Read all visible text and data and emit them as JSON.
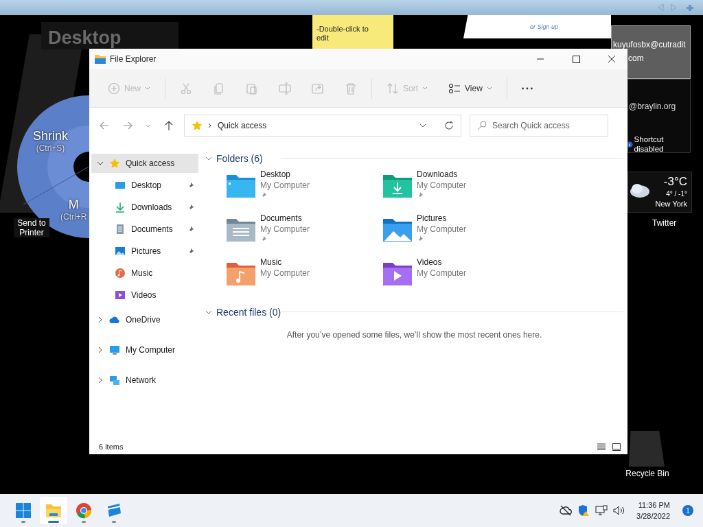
{
  "desktop": {
    "title": "Desktop",
    "disc_labels": [
      {
        "label": "Shrink",
        "shortcut": "(Ctrl+S)"
      },
      {
        "label": "M",
        "shortcut": "(Ctrl+R"
      }
    ],
    "sticky_note": "-Double-click to edit",
    "login_link": "or Sign up",
    "email": {
      "address_lines": [
        "kuyufosbx@cutradit",
        "com"
      ],
      "second_address": "@braylin.org",
      "notice": "Shortcut disabled"
    },
    "weather": {
      "temperature": "-3°C",
      "range": "4° / -1°",
      "city": "New York"
    },
    "icons": [
      {
        "label": "Send to Printer"
      },
      {
        "label": "Twitter"
      },
      {
        "label": "Recycle Bin"
      }
    ]
  },
  "window": {
    "title": "File Explorer",
    "toolbar": [
      {
        "kind": "new",
        "label": "New",
        "disabled": true,
        "dropdown": true
      },
      {
        "kind": "cut",
        "disabled": true
      },
      {
        "kind": "copy",
        "disabled": true
      },
      {
        "kind": "paste",
        "disabled": true
      },
      {
        "kind": "rename",
        "disabled": true
      },
      {
        "kind": "share",
        "disabled": true
      },
      {
        "kind": "delete",
        "disabled": true
      },
      {
        "kind": "sort",
        "label": "Sort",
        "disabled": true,
        "dropdown": true
      },
      {
        "kind": "view",
        "label": "View",
        "disabled": false,
        "dropdown": true
      },
      {
        "kind": "more",
        "disabled": false
      }
    ],
    "address": {
      "path": "Quick access"
    },
    "search": {
      "placeholder": "Search Quick access"
    },
    "sidebar": [
      {
        "label": "Quick access",
        "kind": "star",
        "expanded": true,
        "selected": true,
        "children": [
          {
            "label": "Desktop",
            "kind": "desktop",
            "pinned": true,
            "selected": false
          },
          {
            "label": "Downloads",
            "kind": "downloads",
            "pinned": true,
            "selected": false
          },
          {
            "label": "Documents",
            "kind": "documents",
            "pinned": true,
            "selected": false
          },
          {
            "label": "Pictures",
            "kind": "pictures",
            "pinned": true,
            "selected": false
          },
          {
            "label": "Music",
            "kind": "music",
            "pinned": false,
            "selected": false
          },
          {
            "label": "Videos",
            "kind": "videos",
            "pinned": false,
            "selected": false
          }
        ]
      },
      {
        "label": "OneDrive",
        "kind": "cloud",
        "expanded": false,
        "selected": false
      },
      {
        "label": "My Computer",
        "kind": "computer",
        "expanded": false,
        "selected": false
      },
      {
        "label": "Network",
        "kind": "network",
        "expanded": false,
        "selected": false
      }
    ],
    "folders_section": {
      "title": "Folders (6)",
      "expanded": true,
      "items": [
        {
          "name": "Desktop",
          "location": "My Computer",
          "kind": "desktop",
          "pinned": true
        },
        {
          "name": "Downloads",
          "location": "My Computer",
          "kind": "downloads",
          "pinned": true
        },
        {
          "name": "Documents",
          "location": "My Computer",
          "kind": "documents",
          "pinned": true
        },
        {
          "name": "Pictures",
          "location": "My Computer",
          "kind": "pictures",
          "pinned": true
        },
        {
          "name": "Music",
          "location": "My Computer",
          "kind": "music",
          "pinned": false
        },
        {
          "name": "Videos",
          "location": "My Computer",
          "kind": "videos",
          "pinned": false
        }
      ]
    },
    "recent_section": {
      "title": "Recent files (0)",
      "expanded": true,
      "message": "After you’ve opened some files, we’ll show the most recent ones here."
    },
    "status_bar": {
      "count": "6 items"
    }
  },
  "taskbar": {
    "apps": [
      {
        "kind": "start",
        "selected": false
      },
      {
        "kind": "explorer",
        "selected": true
      },
      {
        "kind": "chrome",
        "selected": false
      },
      {
        "kind": "app",
        "selected": false
      }
    ],
    "time": "11:36 PM",
    "date": "3/28/2022",
    "notifications": "1"
  }
}
